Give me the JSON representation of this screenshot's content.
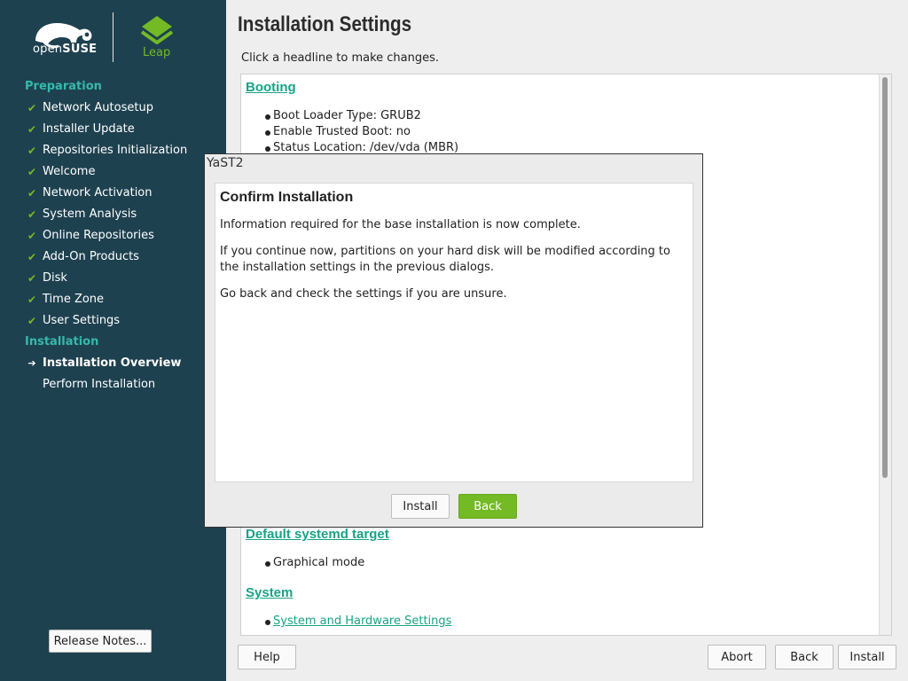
{
  "brand": {
    "suse_logo_name": "opensuse-logo",
    "suse_text_prefix": "open",
    "suse_text_bold": "SUSE",
    "leap_text": "Leap",
    "accent_green": "#73ba25",
    "accent_teal": "#35b9ab",
    "sidebar_bg": "#1e4150"
  },
  "sidebar": {
    "sections": [
      {
        "title": "Preparation",
        "steps": [
          {
            "label": "Network Autosetup",
            "status": "done"
          },
          {
            "label": "Installer Update",
            "status": "done"
          },
          {
            "label": "Repositories Initialization",
            "status": "done"
          },
          {
            "label": "Welcome",
            "status": "done"
          },
          {
            "label": "Network Activation",
            "status": "done"
          },
          {
            "label": "System Analysis",
            "status": "done"
          },
          {
            "label": "Online Repositories",
            "status": "done"
          },
          {
            "label": "Add-On Products",
            "status": "done"
          },
          {
            "label": "Disk",
            "status": "done"
          },
          {
            "label": "Time Zone",
            "status": "done"
          },
          {
            "label": "User Settings",
            "status": "done"
          }
        ]
      },
      {
        "title": "Installation",
        "steps": [
          {
            "label": "Installation Overview",
            "status": "current"
          },
          {
            "label": "Perform Installation",
            "status": "pending"
          }
        ]
      }
    ],
    "release_notes_label": "Release Notes..."
  },
  "main": {
    "title": "Installation Settings",
    "hint": "Click a headline to make changes.",
    "booting": {
      "heading": "Booting",
      "items": [
        "Boot Loader Type: GRUB2",
        "Enable Trusted Boot: no",
        "Status Location: /dev/vda (MBR)"
      ]
    },
    "systemd": {
      "heading": "Default systemd target",
      "items": [
        "Graphical mode"
      ]
    },
    "system": {
      "heading": "System",
      "items": [
        "System and Hardware Settings"
      ]
    }
  },
  "buttons": {
    "help": "Help",
    "abort": "Abort",
    "back": "Back",
    "install": "Install"
  },
  "dialog": {
    "window_title": "YaST2",
    "heading": "Confirm Installation",
    "p1": "Information required for the base installation is now complete.",
    "p2": "If you continue now, partitions on your hard disk will be modified according to the installation settings in the previous dialogs.",
    "p3": "Go back and check the settings if you are unsure.",
    "install_label": "Install",
    "back_label": "Back"
  }
}
